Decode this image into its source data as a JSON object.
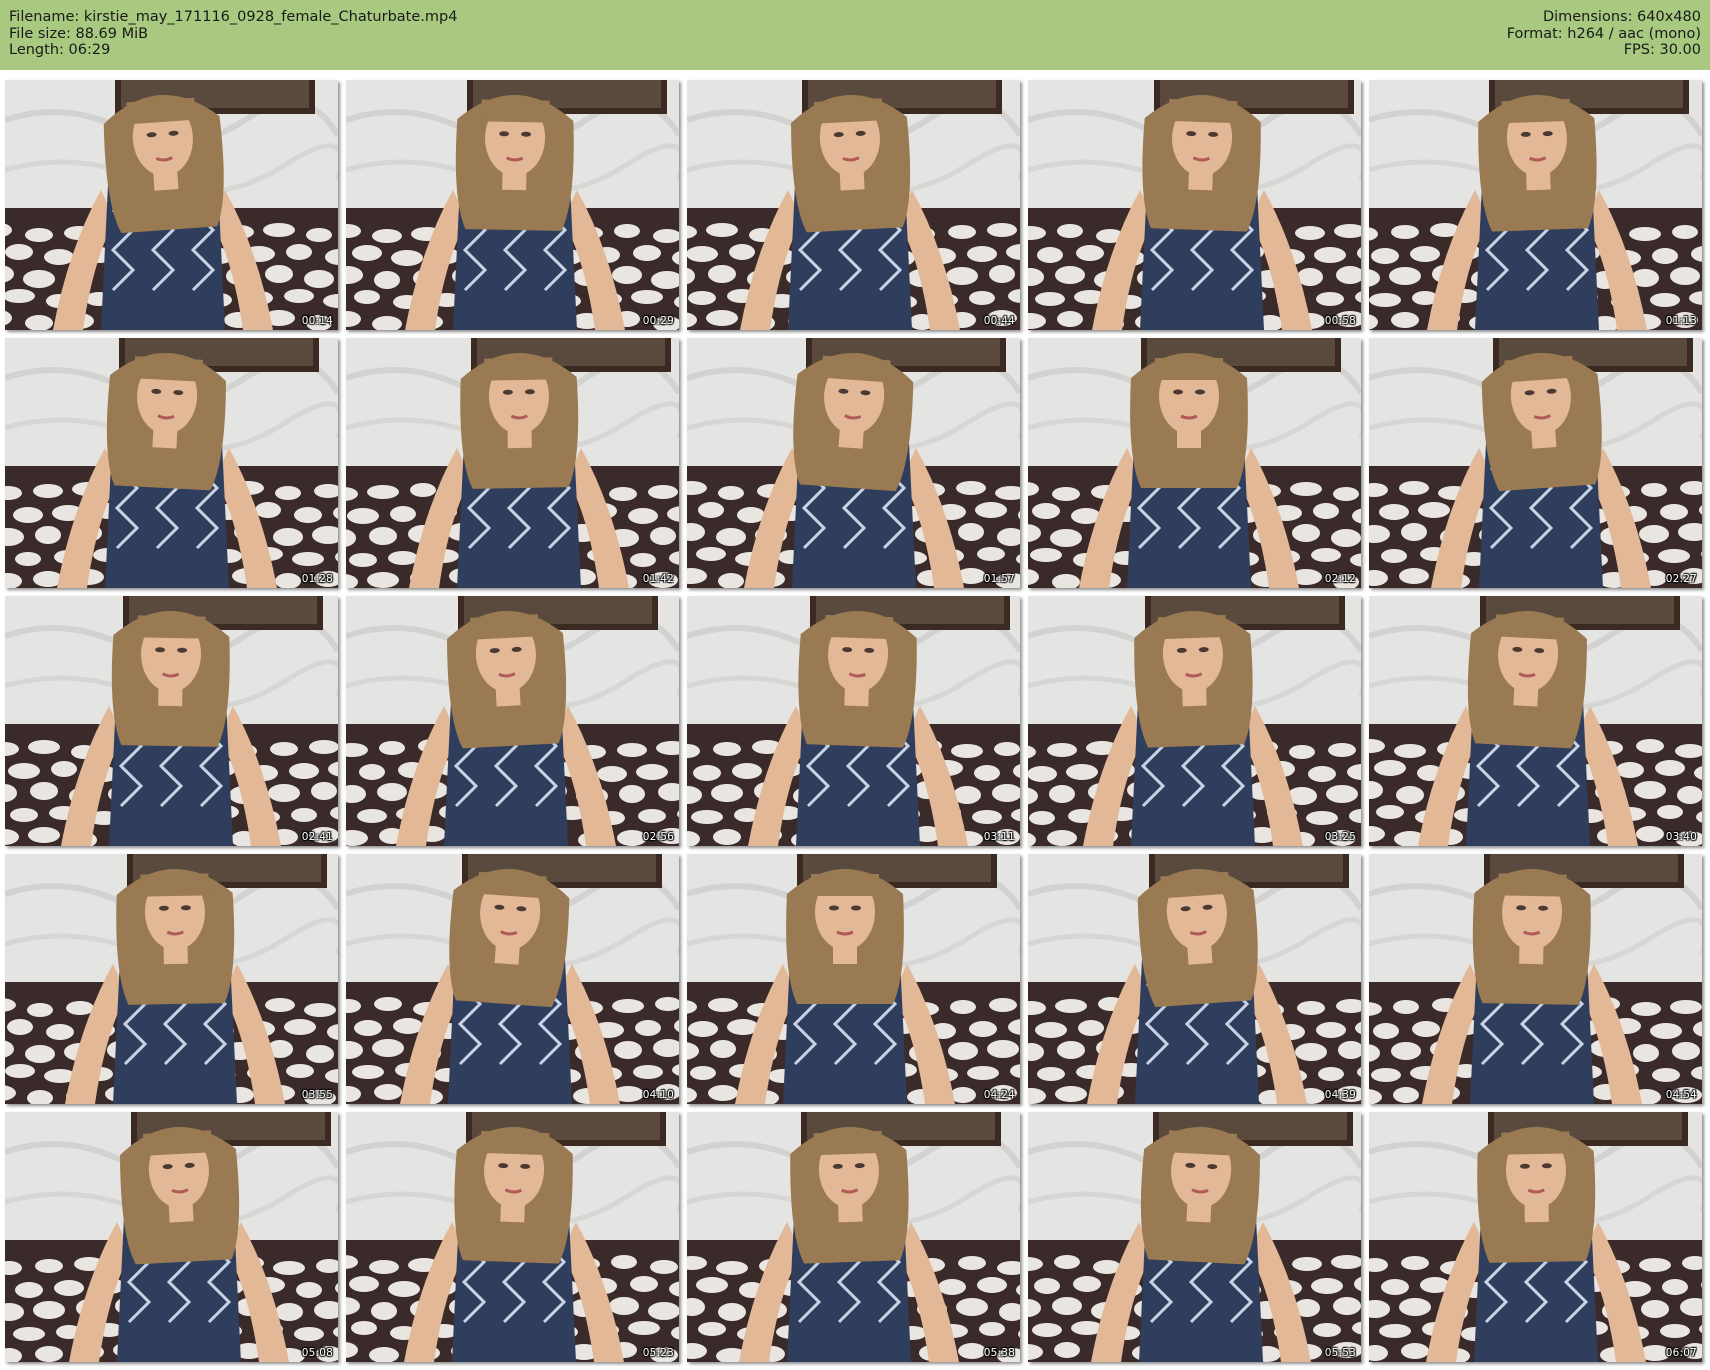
{
  "header": {
    "filename": "Filename: kirstie_may_171116_0928_female_Chaturbate.mp4",
    "file_size": "File size: 88.69 MiB",
    "length": "Length: 06:29",
    "dimensions": "Dimensions: 640x480",
    "format": "Format: h264 / aac (mono)",
    "fps": "FPS: 30.00"
  },
  "colors": {
    "header_bg": "#a8c97f",
    "wall": "#e4e4e2",
    "sofa": "#3a2a2a",
    "sofa_spot": "#e9e6e2",
    "hair": "#9a7a52",
    "skin": "#e2b897",
    "dress": "#2f3e5c"
  },
  "thumbnails": [
    {
      "time": "00:14"
    },
    {
      "time": "00:29"
    },
    {
      "time": "00:44"
    },
    {
      "time": "00:58"
    },
    {
      "time": "01:13"
    },
    {
      "time": "01:28"
    },
    {
      "time": "01:42"
    },
    {
      "time": "01:57"
    },
    {
      "time": "02:12"
    },
    {
      "time": "02:27"
    },
    {
      "time": "02:41"
    },
    {
      "time": "02:56"
    },
    {
      "time": "03:11"
    },
    {
      "time": "03:25"
    },
    {
      "time": "03:40"
    },
    {
      "time": "03:55"
    },
    {
      "time": "04:10"
    },
    {
      "time": "04:24"
    },
    {
      "time": "04:39"
    },
    {
      "time": "04:54"
    },
    {
      "time": "05:08"
    },
    {
      "time": "05:23"
    },
    {
      "time": "05:38"
    },
    {
      "time": "05:53"
    },
    {
      "time": "06:07"
    }
  ]
}
